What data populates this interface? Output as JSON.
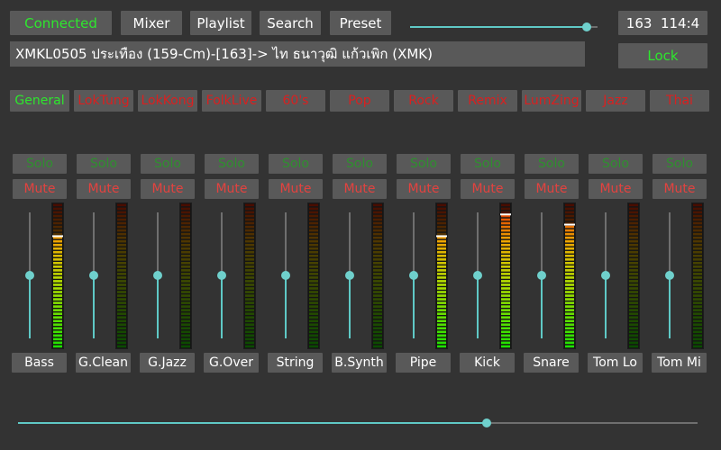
{
  "topbar": {
    "connection_status": "Connected",
    "tabs": [
      "Mixer",
      "Playlist",
      "Search",
      "Preset"
    ],
    "top_slider_value": 0.94,
    "counter": "163  114:4",
    "lock_label": "Lock"
  },
  "song": {
    "title": "XMKL0505 ประเทือง (159-Cm)-[163]-> ไท ธนาวุฒิ แก้วเพิก (XMK)"
  },
  "categories": [
    {
      "label": "General",
      "active": true
    },
    {
      "label": "LokTung",
      "active": false
    },
    {
      "label": "LokKong",
      "active": false
    },
    {
      "label": "FolkLive",
      "active": false
    },
    {
      "label": "60's",
      "active": false
    },
    {
      "label": "Pop",
      "active": false
    },
    {
      "label": "Rock",
      "active": false
    },
    {
      "label": "Remix",
      "active": false
    },
    {
      "label": "LumZing",
      "active": false
    },
    {
      "label": "Jazz",
      "active": false
    },
    {
      "label": "Thai",
      "active": false
    }
  ],
  "channel_buttons": {
    "solo_label": "Solo",
    "mute_label": "Mute"
  },
  "channels": [
    {
      "name": "Bass",
      "fader": 0.5,
      "level": 0.78,
      "peak": 0.78
    },
    {
      "name": "G.Clean",
      "fader": 0.5,
      "level": 0.0,
      "peak": 0.0
    },
    {
      "name": "G.Jazz",
      "fader": 0.5,
      "level": 0.0,
      "peak": 0.0
    },
    {
      "name": "G.Over",
      "fader": 0.5,
      "level": 0.0,
      "peak": 0.0
    },
    {
      "name": "String",
      "fader": 0.5,
      "level": 0.0,
      "peak": 0.0
    },
    {
      "name": "B.Synth",
      "fader": 0.5,
      "level": 0.0,
      "peak": 0.0
    },
    {
      "name": "Pipe",
      "fader": 0.5,
      "level": 0.78,
      "peak": 0.78
    },
    {
      "name": "Kick",
      "fader": 0.5,
      "level": 0.93,
      "peak": 0.93
    },
    {
      "name": "Snare",
      "fader": 0.5,
      "level": 0.86,
      "peak": 0.86
    },
    {
      "name": "Tom Lo",
      "fader": 0.5,
      "level": 0.0,
      "peak": 0.0
    },
    {
      "name": "Tom Mi",
      "fader": 0.5,
      "level": 0.0,
      "peak": 0.0
    }
  ],
  "master_slider_value": 0.69,
  "colors": {
    "accent": "#5fc9c6",
    "status_green": "#2ee62e",
    "category_red": "#d92020",
    "mute_red": "#e3423f",
    "button_bg": "#595959",
    "background": "#333333"
  }
}
